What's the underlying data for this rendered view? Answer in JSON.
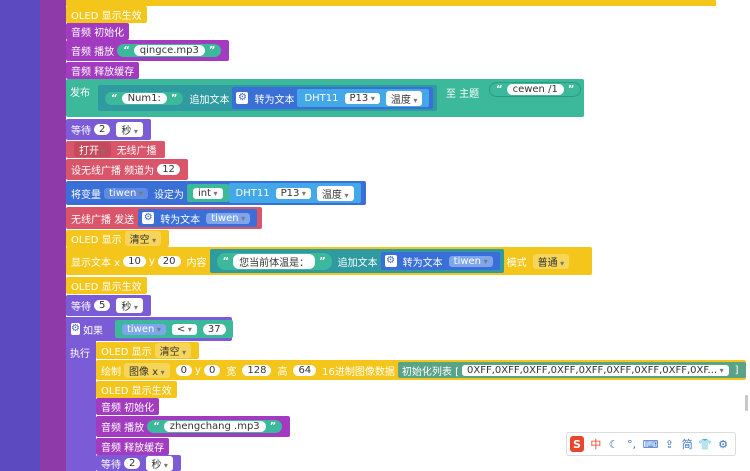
{
  "colors": {
    "left_bar": "#5b4ac0",
    "outer_block": "#8e3aa8",
    "yellow": "#f4c51b",
    "purple": "#a23bbf",
    "teal": "#3cb89a",
    "red": "#d8556a",
    "blue": "#3a6fd8",
    "light_blue": "#42a8e8"
  },
  "blocks": {
    "oled_show_1": "OLED 显示生效",
    "audio_init_1": "音频 初始化",
    "audio_play_1_label": "音频 播放",
    "audio_play_1_file": "qingce.mp3",
    "audio_release_1": "音频 释放缓存",
    "publish_label": "发布",
    "publish_text": "Num1:",
    "append_text": "追加文本",
    "to_text": "转为文本",
    "dht_label": "DHT11",
    "dht_pin": "P13",
    "dht_measure": "温度",
    "topic_label": "至 主题",
    "topic_value": "cewen /1",
    "wait_1_label": "等待",
    "wait_1_value": "2",
    "wait_1_unit": "秒",
    "radio_on": "打开",
    "radio_label": "无线广播",
    "radio_channel_label": "设无线广播 频道为",
    "radio_channel_value": "12",
    "var_label": "将变量",
    "var_name": "tiwen",
    "set_as": "设定为",
    "int_label": "int",
    "dht2_label": "DHT11",
    "dht2_pin": "P13",
    "dht2_measure": "温度",
    "radio_send_label": "无线广播 发送",
    "radio_send_to_text": "转为文本",
    "radio_send_var": "tiwen",
    "oled_display_label": "OLED 显示",
    "oled_clear": "清空",
    "show_text_label": "显示文本 x",
    "show_x": "10",
    "show_y_label": "y",
    "show_y": "20",
    "show_content_label": "内容",
    "show_str": "您当前体温是：",
    "show_append": "追加文本",
    "show_to_text": "转为文本",
    "show_var": "tiwen",
    "show_mode_label": "模式",
    "show_mode": "普通",
    "oled_show_2": "OLED 显示生效",
    "wait_2_label": "等待",
    "wait_2_value": "5",
    "wait_2_unit": "秒",
    "if_label": "如果",
    "if_var": "tiwen",
    "if_op": "<",
    "if_value": "37",
    "do_label": "执行",
    "do_oled_display": "OLED 显示",
    "do_oled_clear": "清空",
    "draw_label": "绘制",
    "draw_image_x": "图像 x",
    "draw_x": "0",
    "draw_y_label": "y",
    "draw_y": "0",
    "draw_w_label": "宽",
    "draw_w": "128",
    "draw_h_label": "高",
    "draw_h": "64",
    "draw_hex_label": "16进制图像数据",
    "draw_init_list": "初始化列表 [",
    "draw_list_values": "0XFF,0XFF,0XFF,0XFF,0XFF,0XFF,0XFF,0XFF,0XF...",
    "draw_list_end": "]",
    "do_oled_show": "OLED 显示生效",
    "do_audio_init": "音频 初始化",
    "do_audio_play_label": "音频 播放",
    "do_audio_play_file": "zhengchang .mp3",
    "do_audio_release": "音频 释放缓存",
    "do_wait_label": "等待",
    "do_wait_value": "2",
    "do_wait_unit": "秒"
  },
  "ime_toolbar": {
    "logo": "S",
    "lang": "中",
    "items": [
      "moon-icon",
      "punctuation-icon",
      "keyboard-icon",
      "upload-icon",
      "simplified-label",
      "shirt-icon",
      "settings-icon"
    ],
    "simplified": "简"
  }
}
